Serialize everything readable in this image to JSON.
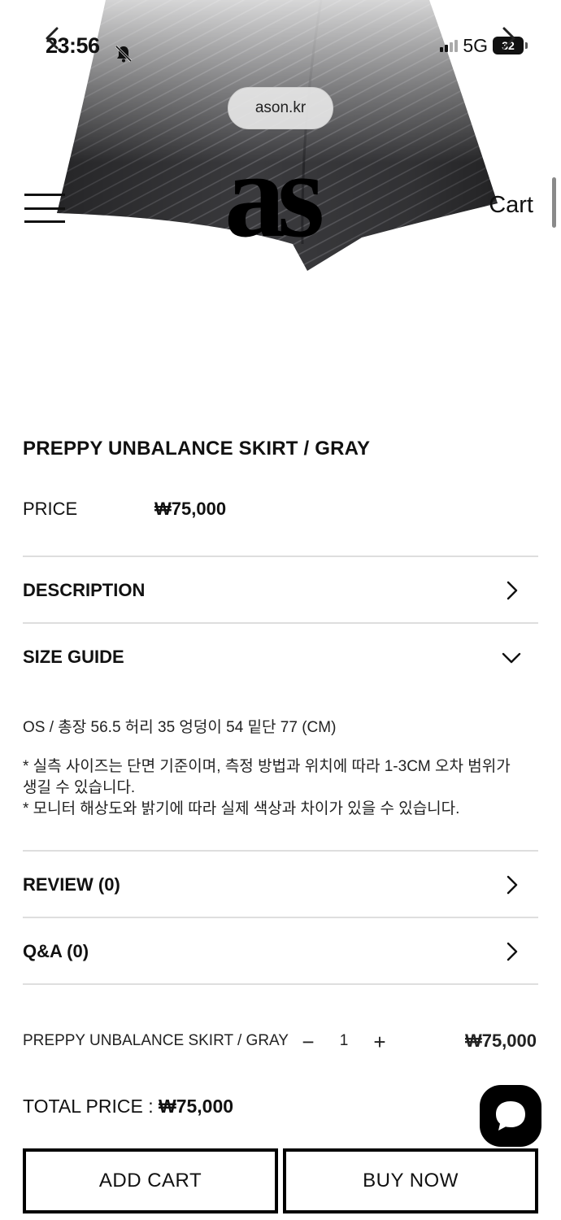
{
  "status_bar": {
    "time": "23:56",
    "network": "5G",
    "battery": "32"
  },
  "browser": {
    "url": "ason.kr"
  },
  "header": {
    "logo": "as",
    "cart_label": "Cart"
  },
  "product": {
    "title": "PREPPY UNBALANCE SKIRT / GRAY",
    "price_label": "PRICE",
    "price": "₩75,000"
  },
  "sections": {
    "description": "DESCRIPTION",
    "size_guide": "SIZE GUIDE",
    "review": "REVIEW (0)",
    "qa": "Q&A (0)"
  },
  "size_guide": {
    "measurements": "OS / 총장 56.5 허리 35 엉덩이 54 밑단 77 (CM)",
    "note1": "* 실측 사이즈는 단면 기준이며, 측정 방법과 위치에 따라 1-3CM 오차 범위가 생길 수 있습니다.",
    "note2": "* 모니터 해상도와 밝기에 따라 실제 색상과 차이가 있을 수 있습니다."
  },
  "option": {
    "name": "PREPPY UNBALANCE SKIRT / GRAY",
    "minus": "−",
    "quantity": "1",
    "plus": "+",
    "price": "₩75,000"
  },
  "total": {
    "label": "TOTAL PRICE : ",
    "value": "₩75,000"
  },
  "actions": {
    "add_cart": "ADD CART",
    "buy_now": "BUY NOW"
  },
  "icons": {
    "menu": "hamburger-icon",
    "chevron_right": "chevron-right-icon",
    "chevron_down": "chevron-down-icon",
    "chat": "chat-bubble-icon",
    "bell_muted": "bell-slash-icon"
  }
}
